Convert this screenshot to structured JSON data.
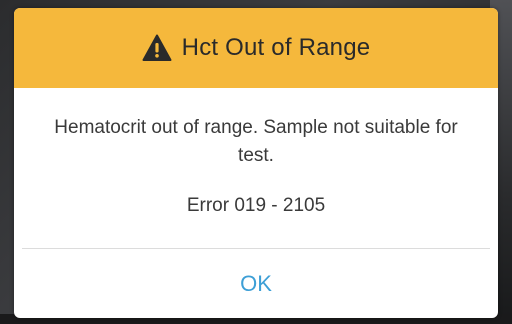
{
  "dialog": {
    "title": "Hct Out of Range",
    "title_icon": "warning-icon",
    "message": "Hematocrit out of range. Sample not suitable for test.",
    "error_code": "Error 019 - 2105",
    "ok_label": "OK"
  },
  "colors": {
    "header_background": "#f5b83c",
    "button_text": "#3d9fd6",
    "icon": "#2a2a2a"
  }
}
